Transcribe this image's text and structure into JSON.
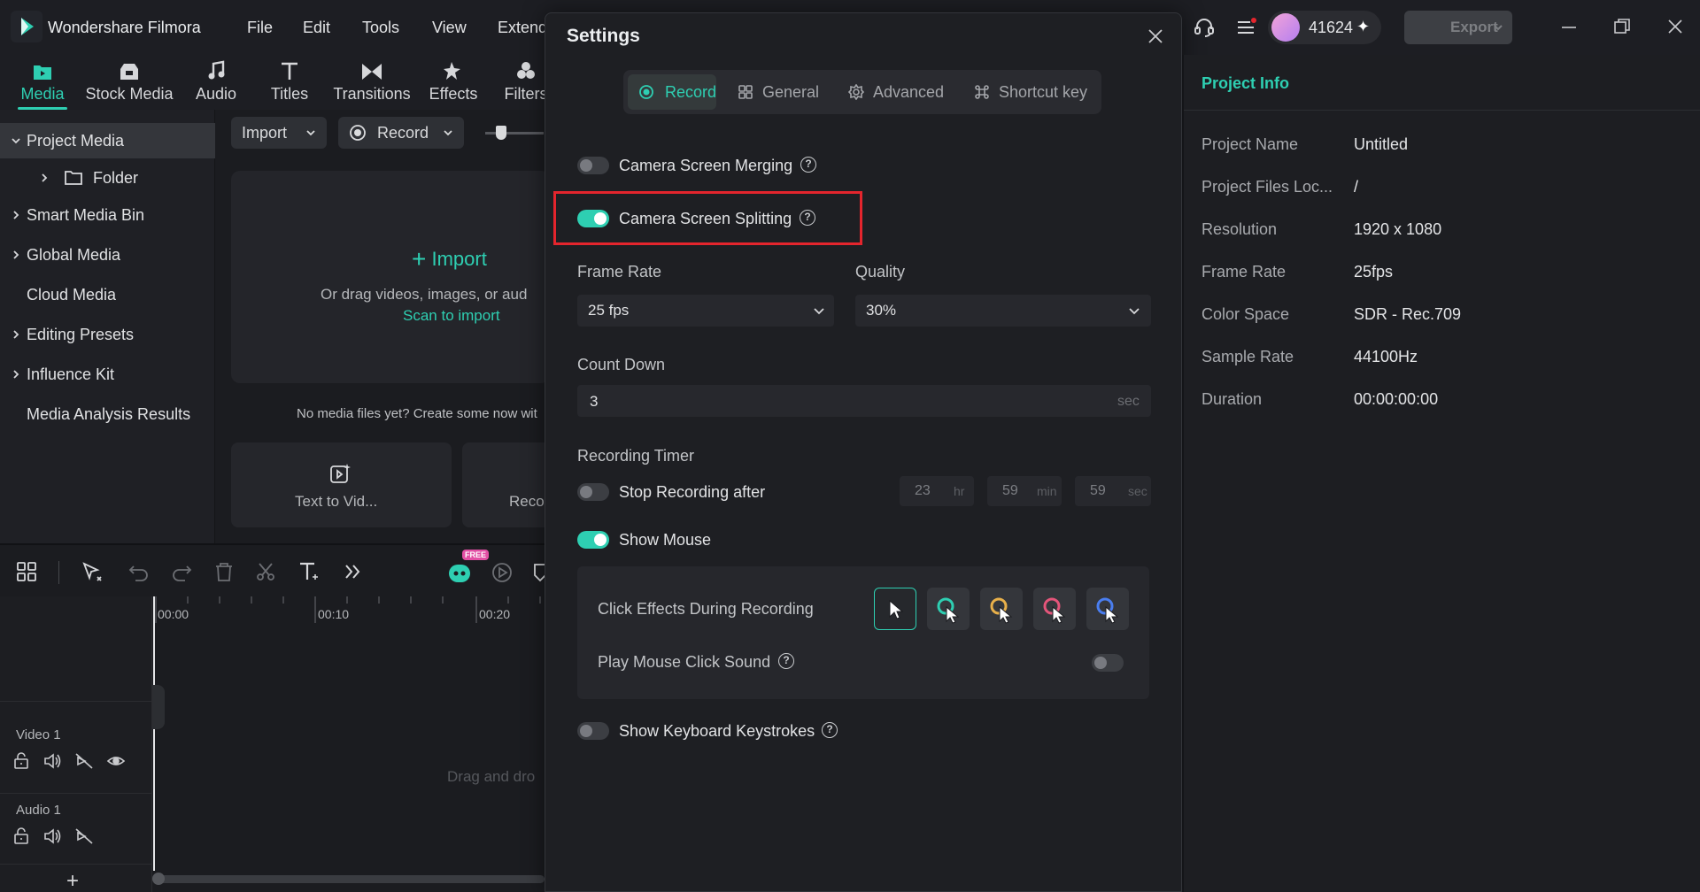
{
  "app": {
    "title": "Wondershare Filmora",
    "menus": [
      "File",
      "Edit",
      "Tools",
      "View",
      "Extend"
    ],
    "account_label": "41624",
    "export_label": "Export"
  },
  "tabs": [
    "Media",
    "Stock Media",
    "Audio",
    "Titles",
    "Transitions",
    "Effects",
    "Filters"
  ],
  "left_panel": {
    "items": [
      "Project Media",
      "Folder",
      "Smart Media Bin",
      "Global Media",
      "Cloud Media",
      "Editing Presets",
      "Influence Kit",
      "Media Analysis Results"
    ]
  },
  "media": {
    "import_label": "Import",
    "record_label": "Record",
    "drop_import_label": "Import",
    "drop_hint": "Or drag videos, images, or aud",
    "scan_label": "Scan to import",
    "empty_hint": "No media files yet? Create some now wit",
    "card1_label": "Text to Vid...",
    "card2_label": "Reco"
  },
  "timeline": {
    "ticks": [
      "00:00",
      "00:10",
      "00:20"
    ],
    "tracks": [
      "Video 1",
      "Audio 1"
    ],
    "drag_hint": "Drag and dro",
    "free_badge": "FREE"
  },
  "settings": {
    "title": "Settings",
    "segments": [
      "Record",
      "General",
      "Advanced",
      "Shortcut key"
    ],
    "camera_merging": "Camera Screen Merging",
    "camera_splitting": "Camera Screen Splitting",
    "frame_rate_label": "Frame Rate",
    "frame_rate_value": "25 fps",
    "quality_label": "Quality",
    "quality_value": "30%",
    "countdown_label": "Count Down",
    "countdown_value": "3",
    "countdown_unit": "sec",
    "recording_timer_label": "Recording Timer",
    "stop_recording_label": "Stop Recording after",
    "timer": {
      "hr": "23",
      "hr_unit": "hr",
      "min": "59",
      "min_unit": "min",
      "sec": "59",
      "sec_unit": "sec"
    },
    "show_mouse_label": "Show Mouse",
    "click_effects_label": "Click Effects During Recording",
    "click_sound_label": "Play Mouse Click Sound",
    "keystrokes_label": "Show Keyboard Keystrokes",
    "toggles": {
      "camera_merging": false,
      "camera_splitting": true,
      "stop_recording": false,
      "show_mouse": true,
      "click_sound": false,
      "keystrokes": false
    },
    "cursor_effect_colors": [
      "#ffffff",
      "#2ecfb2",
      "#e8b04a",
      "#e4557a",
      "#4a7ef0"
    ]
  },
  "project_info": {
    "title": "Project Info",
    "rows": [
      {
        "label": "Project Name",
        "value": "Untitled"
      },
      {
        "label": "Project Files Loc...",
        "value": "/"
      },
      {
        "label": "Resolution",
        "value": "1920 x 1080"
      },
      {
        "label": "Frame Rate",
        "value": "25fps"
      },
      {
        "label": "Color Space",
        "value": "SDR - Rec.709"
      },
      {
        "label": "Sample Rate",
        "value": "44100Hz"
      },
      {
        "label": "Duration",
        "value": "00:00:00:00"
      }
    ]
  },
  "colors": {
    "accent": "#2ecfb2",
    "highlight_box": "#e4252d"
  }
}
